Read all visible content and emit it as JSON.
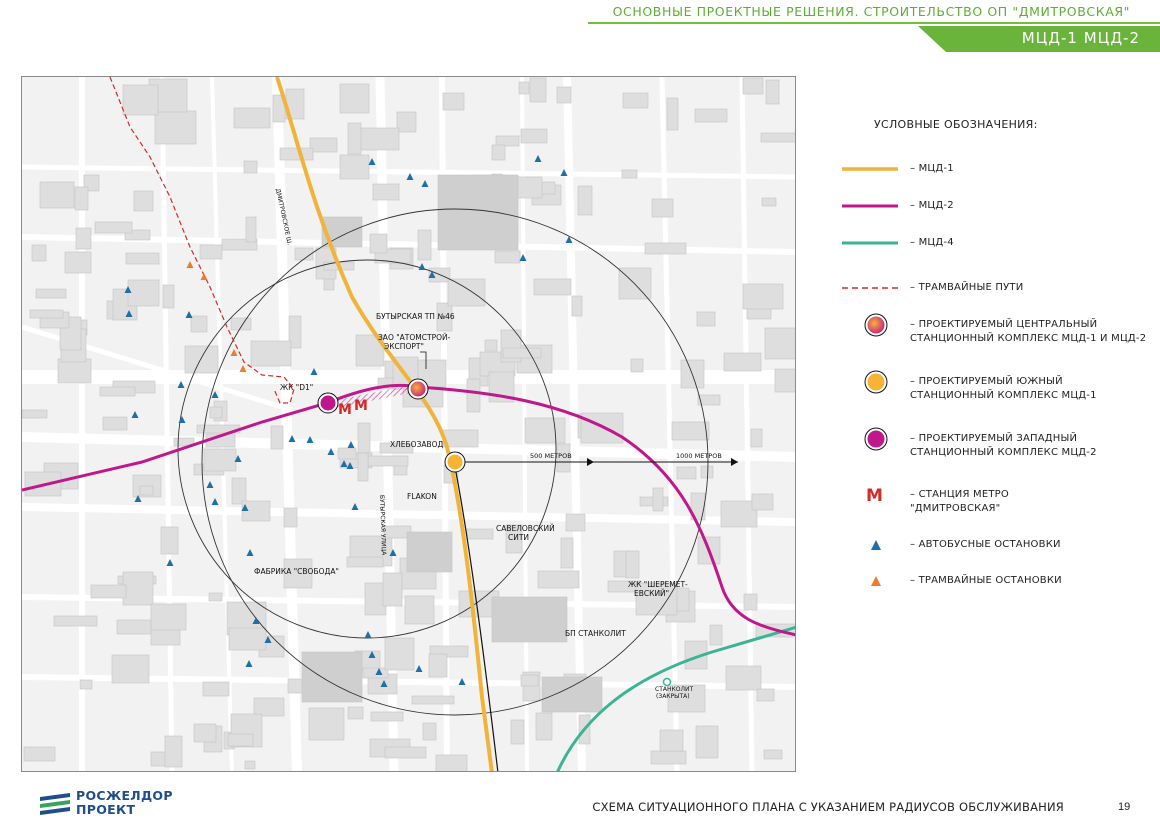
{
  "header": {
    "title": "ОСНОВНЫЕ ПРОЕКТНЫЕ РЕШЕНИЯ. СТРОИТЕЛЬСТВО ОП \"ДМИТРОВСКАЯ\"",
    "subtitle": "МЦД-1  МЦД-2"
  },
  "map": {
    "labels": {
      "zhk_d1": "ЖК \"D1\"",
      "butyrskaya_tp": "БУТЫРСКАЯ ТП №46",
      "atomstroy": "ЗАО \"АТОМСТРОЙ-\nЭКСПОРТ\"",
      "khlebozavod": "ХЛЕБОЗАВОД",
      "flakon": "FLAKON",
      "savelovsky_city": "САВЕЛОВСКИЙ\nСИТИ",
      "fabrika_svoboda": "ФАБРИКА \"СВОБОДА\"",
      "zhk_sheremetevsky": "ЖК \"ШЕРЕМЕТ-\nЕВСКИЙ\"",
      "bp_stankolit": "БП СТАНКОЛИТ",
      "stankolit_station": "СТАНКОЛИТ\n(ЗАКРЫТА)",
      "radius_500": "500 МЕТРОВ",
      "radius_1000": "1000 МЕТРОВ",
      "street_dmitrovskoe": "ДМИТРОВСКОЕ Ш.",
      "street_butyrskaya": "БУТЫРСКАЯ УЛИЦА"
    },
    "colors": {
      "mcd1": "#f0b43c",
      "mcd2": "#c0178b",
      "mcd4": "#3ab493",
      "tram": "#d32a2a",
      "bus_stop": "#1f6fa8",
      "tram_stop": "#ee7d2a"
    }
  },
  "legend": {
    "title": "УСЛОВНЫЕ ОБОЗНАЧЕНИЯ:",
    "items": [
      {
        "key": "mcd1",
        "symbol": "line-yellow-icon",
        "text": "– МЦД-1"
      },
      {
        "key": "mcd2",
        "symbol": "line-magenta-icon",
        "text": "– МЦД-2"
      },
      {
        "key": "mcd4",
        "symbol": "line-green-icon",
        "text": "– МЦД-4"
      },
      {
        "key": "tram",
        "symbol": "dashed-red-line-icon",
        "text": "– ТРАМВАЙНЫЕ ПУТИ"
      },
      {
        "key": "central",
        "symbol": "gradient-station-icon",
        "text": "– ПРОЕКТИРУЕМЫЙ ЦЕНТРАЛЬНЫЙ\nСТАНЦИОННЫЙ КОМПЛЕКС МЦД-1 И МЦД-2"
      },
      {
        "key": "south",
        "symbol": "orange-station-icon",
        "text": "– ПРОЕКТИРУЕМЫЙ ЮЖНЫЙ\nСТАНЦИОННЫЙ КОМПЛЕКС МЦД-1"
      },
      {
        "key": "west",
        "symbol": "magenta-station-icon",
        "text": "– ПРОЕКТИРУЕМЫЙ ЗАПАДНЫЙ\nСТАНЦИОННЫЙ КОМПЛЕКС МЦД-2"
      },
      {
        "key": "metro",
        "symbol": "metro-icon",
        "text": "–  СТАНЦИЯ МЕТРО\n\"ДМИТРОВСКАЯ\""
      },
      {
        "key": "bus",
        "symbol": "bus-stop-icon",
        "text": "–  АВТОБУСНЫЕ ОСТАНОВКИ"
      },
      {
        "key": "tramstop",
        "symbol": "tram-stop-icon",
        "text": "–  ТРАМВАЙНЫЕ ОСТАНОВКИ"
      }
    ]
  },
  "footer": {
    "logo_text": "РОСЖЕЛДОР\nПРОЕКТ",
    "caption": "СХЕМА СИТУАЦИОННОГО ПЛАНА С УКАЗАНИЕМ РАДИУСОВ ОБСЛУЖИВАНИЯ",
    "page_number": "19"
  }
}
